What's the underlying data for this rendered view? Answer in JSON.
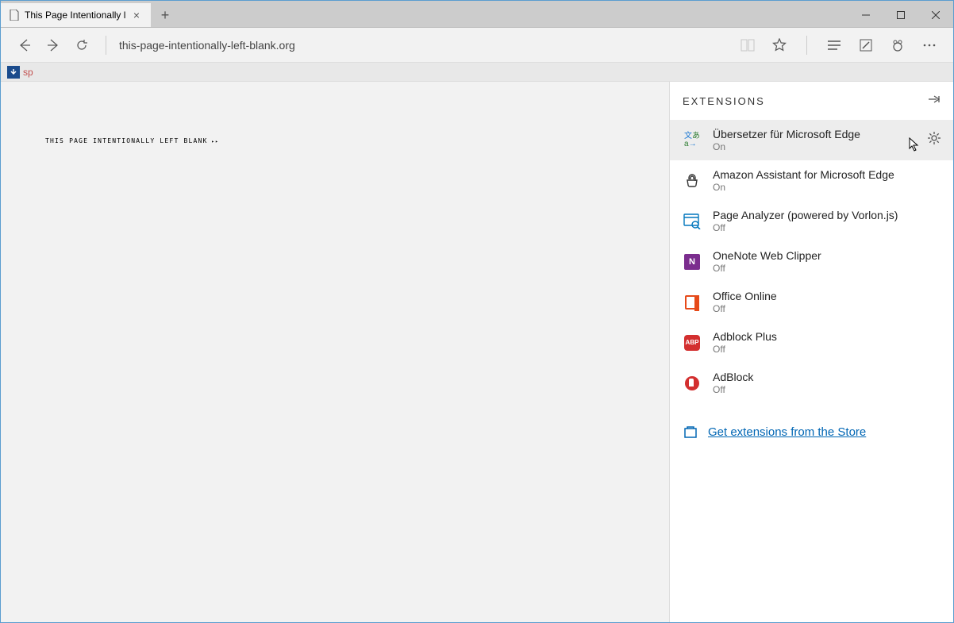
{
  "tab": {
    "title": "This Page Intentionally l"
  },
  "url": "this-page-intentionally-left-blank.org",
  "bookmark": {
    "label": "sp"
  },
  "page": {
    "text": "THIS PAGE INTENTIONALLY LEFT BLANK"
  },
  "panel": {
    "title": "EXTENSIONS",
    "store_link": "Get extensions from the Store",
    "items": [
      {
        "name": "Übersetzer für Microsoft Edge",
        "status": "On",
        "icon": "translate",
        "selected": true
      },
      {
        "name": "Amazon Assistant for Microsoft Edge",
        "status": "On",
        "icon": "amazon"
      },
      {
        "name": "Page Analyzer (powered by Vorlon.js)",
        "status": "Off",
        "icon": "analyzer"
      },
      {
        "name": "OneNote Web Clipper",
        "status": "Off",
        "icon": "onenote"
      },
      {
        "name": "Office Online",
        "status": "Off",
        "icon": "office"
      },
      {
        "name": "Adblock Plus",
        "status": "Off",
        "icon": "abp"
      },
      {
        "name": "AdBlock",
        "status": "Off",
        "icon": "adblock"
      }
    ]
  }
}
